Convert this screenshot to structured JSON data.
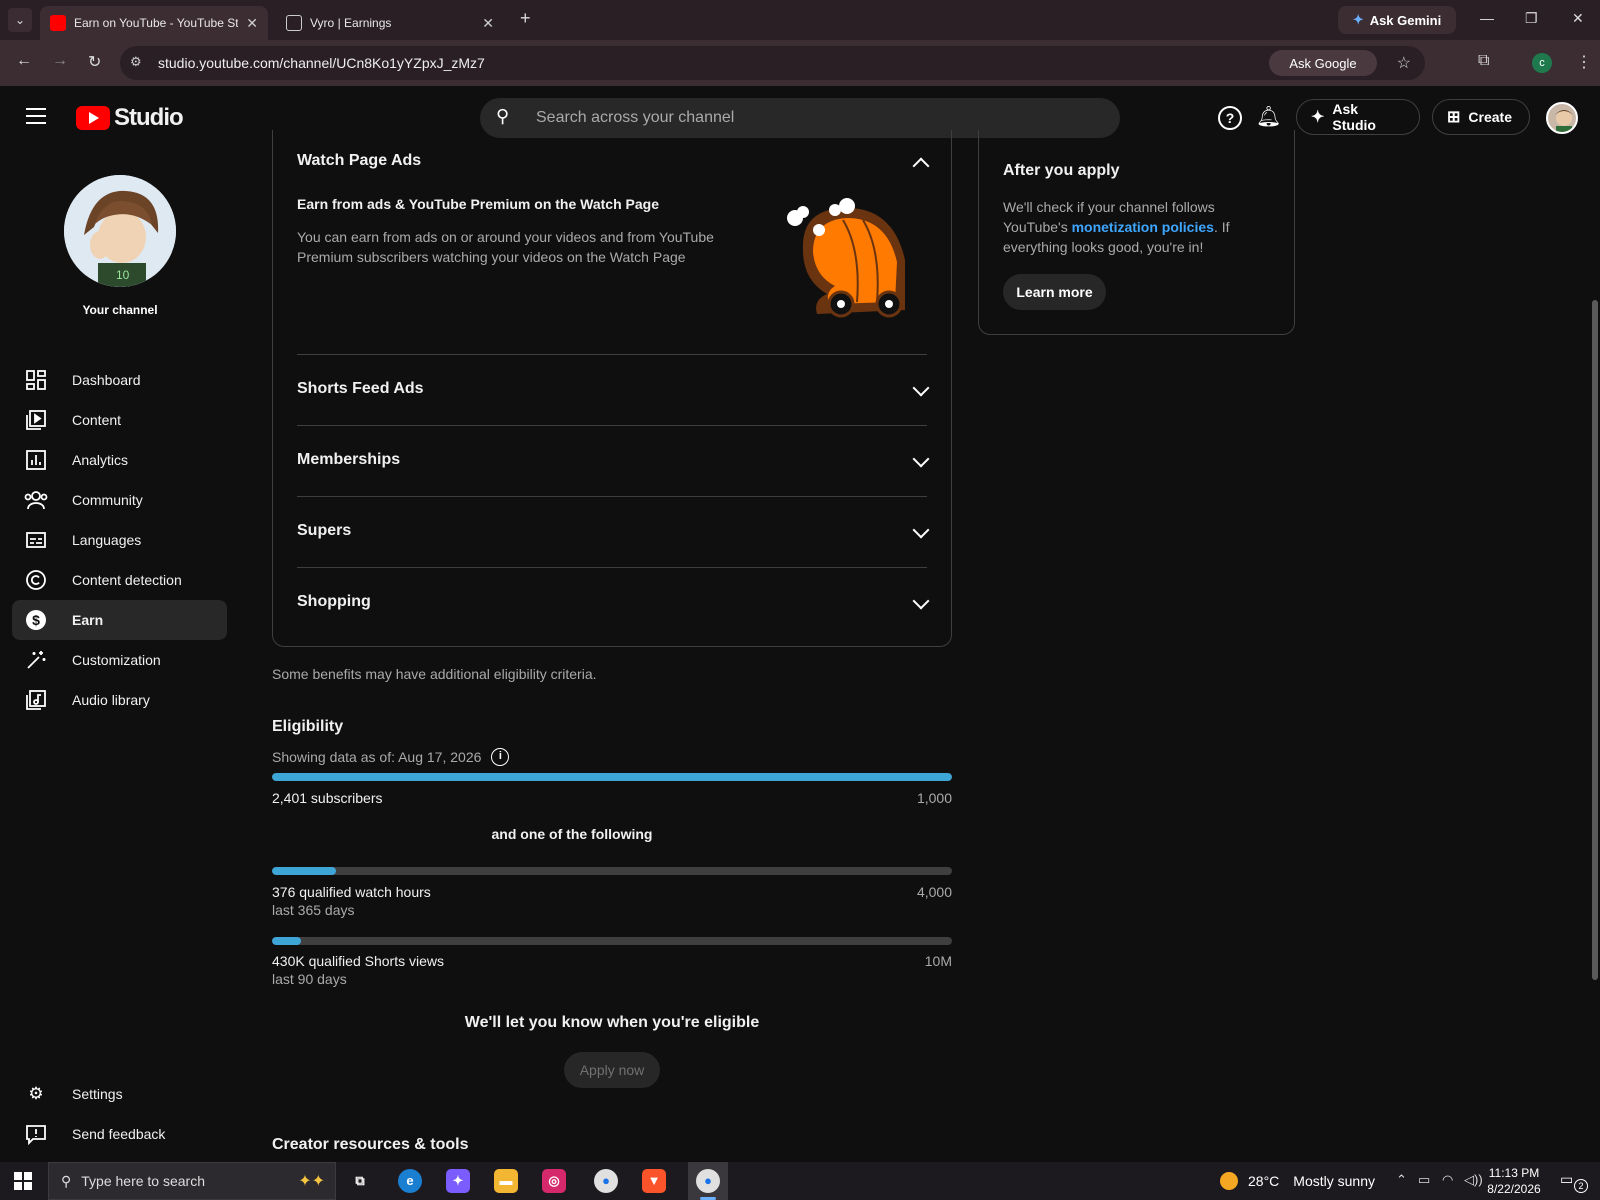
{
  "browser": {
    "tabs": [
      {
        "title": "Earn on YouTube - YouTube Studio",
        "active": true
      },
      {
        "title": "Vyro | Earnings",
        "active": false
      }
    ],
    "ask_gemini": "Ask Gemini",
    "url": "studio.youtube.com/channel/UCn8Ko1yYZpxJ_zMz7",
    "ask_google": "Ask Google",
    "profile_initial": "c"
  },
  "header": {
    "logo_text": "Studio",
    "search_placeholder": "Search across your channel",
    "ask_studio": "Ask Studio",
    "create": "Create"
  },
  "sidebar": {
    "channel_label": "Your channel",
    "items": [
      {
        "label": "Dashboard",
        "icon": "dashboard-icon"
      },
      {
        "label": "Content",
        "icon": "content-icon"
      },
      {
        "label": "Analytics",
        "icon": "analytics-icon"
      },
      {
        "label": "Community",
        "icon": "community-icon"
      },
      {
        "label": "Languages",
        "icon": "subtitles-icon"
      },
      {
        "label": "Content detection",
        "icon": "copyright-icon"
      },
      {
        "label": "Earn",
        "icon": "dollar-icon",
        "active": true
      },
      {
        "label": "Customization",
        "icon": "magic-wand-icon"
      },
      {
        "label": "Audio library",
        "icon": "audio-library-icon"
      }
    ],
    "bottom": [
      {
        "label": "Settings",
        "icon": "gear-icon"
      },
      {
        "label": "Send feedback",
        "icon": "feedback-icon"
      }
    ]
  },
  "benefits": {
    "watch_page": {
      "title": "Watch Page Ads",
      "subtitle": "Earn from ads & YouTube Premium on the Watch Page",
      "body": "You can earn from ads on or around your videos and from YouTube Premium subscribers watching your videos on the Watch Page"
    },
    "sections": [
      "Shorts Feed Ads",
      "Memberships",
      "Supers",
      "Shopping"
    ],
    "note": "Some benefits may have additional eligibility criteria."
  },
  "eligibility": {
    "title": "Eligibility",
    "date_label": "Showing data as of: Aug 17, 2026",
    "subscribers": {
      "label": "2,401 subscribers",
      "target": "1,000",
      "progress": 1.0
    },
    "and_one": "and one of the following",
    "watch_hours": {
      "label": "376 qualified watch hours",
      "sub": "last 365 days",
      "target": "4,000",
      "progress": 0.094
    },
    "shorts_views": {
      "label": "430K qualified Shorts views",
      "sub": "last 90 days",
      "target": "10M",
      "progress": 0.043
    },
    "let_know": "We'll let you know when you're eligible",
    "apply": "Apply now"
  },
  "creator_title": "Creator resources & tools",
  "after_apply": {
    "title": "After you apply",
    "body_1": "We'll check if your channel follows YouTube's ",
    "link": "monetization policies",
    "body_2": ". If everything looks good, you're in!",
    "button": "Learn more"
  },
  "taskbar": {
    "search_placeholder": "Type here to search",
    "temperature": "28°C",
    "condition": "Mostly sunny",
    "time": "11:13 PM",
    "date": "8/22/2026",
    "notifications": "2"
  },
  "colors": {
    "accent": "#3ea6d6",
    "link": "#3ea6ff",
    "brand_red": "#ff0000"
  }
}
